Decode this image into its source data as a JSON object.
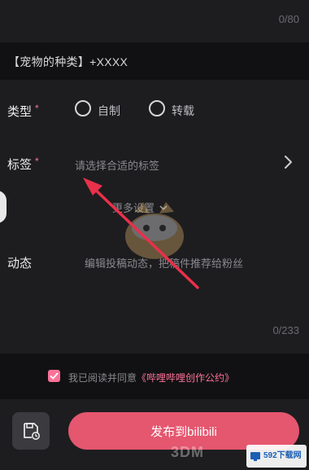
{
  "header": {
    "char_counter": "0/80"
  },
  "title_field": {
    "value": "【宠物的种类】+XXXX"
  },
  "type_row": {
    "label": "类型",
    "required_mark": "*",
    "options": [
      {
        "label": "自制",
        "selected": false
      },
      {
        "label": "转载",
        "selected": false
      }
    ]
  },
  "tags_row": {
    "label": "标签",
    "required_mark": "*",
    "placeholder": "请选择合适的标签"
  },
  "more_settings": {
    "label": "更多设置"
  },
  "dynamic_row": {
    "label": "动态",
    "placeholder": "编辑投稿动态，把稿件推荐给粉丝",
    "counter": "0/233"
  },
  "agreement": {
    "checked": true,
    "prefix": "我已阅读并同意",
    "link": "《哔哩哔哩创作公约》"
  },
  "footer": {
    "draft_icon": "save-draft-icon",
    "publish_label": "发布到bilibili"
  },
  "watermarks": {
    "brand_3dm": "3DM",
    "site_592": "592下载网"
  },
  "colors": {
    "accent": "#fb7299",
    "publish_button": "#e5566f",
    "annotation_arrow": "#e8314a",
    "panel": "#1d1d20",
    "background": "#111113"
  }
}
